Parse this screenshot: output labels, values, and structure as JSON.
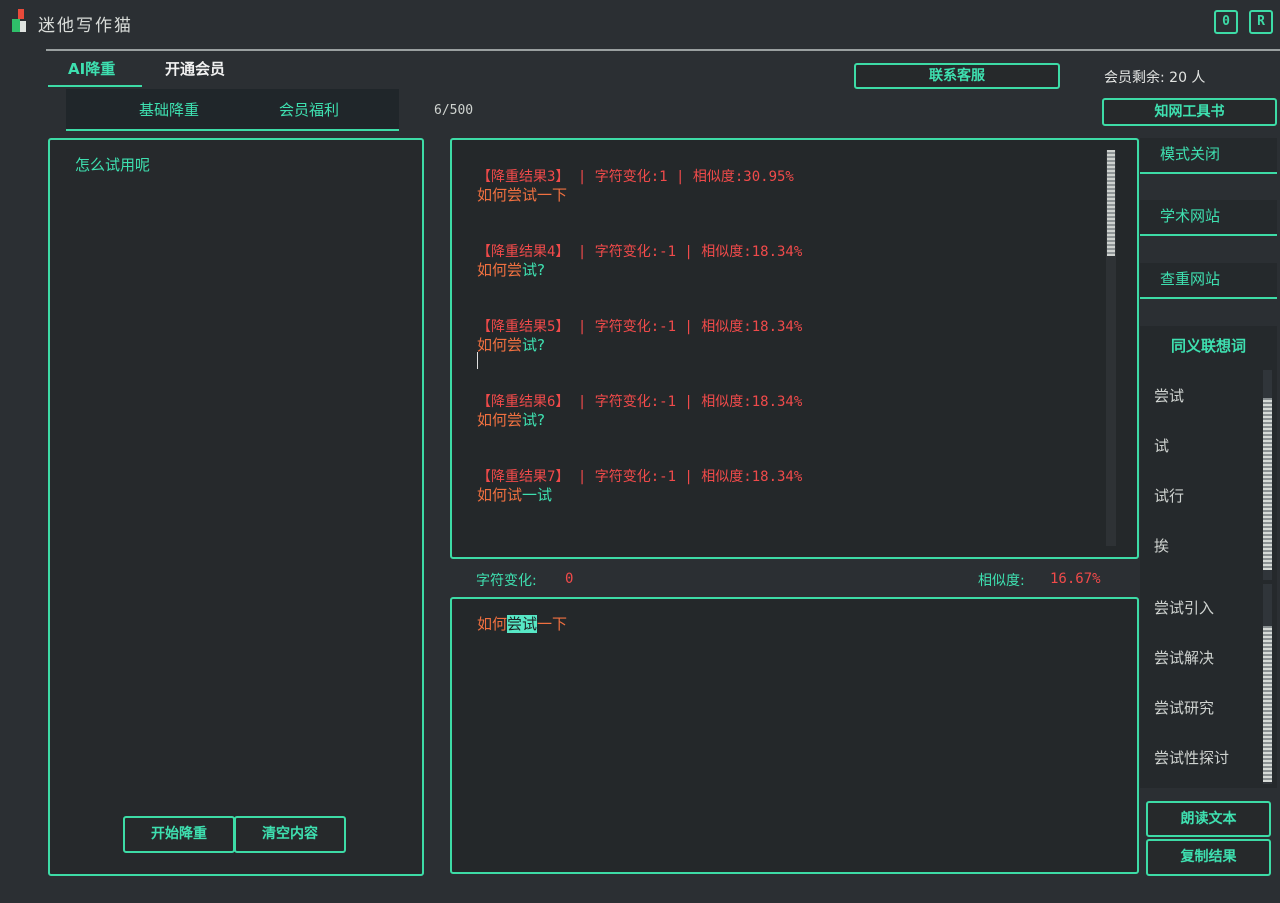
{
  "app": {
    "title": "迷他写作猫",
    "window_buttons": [
      "0",
      "R"
    ]
  },
  "top_tabs": [
    {
      "label": "AI降重",
      "active": true
    },
    {
      "label": "开通会员",
      "active": false
    }
  ],
  "sub_tabs": [
    {
      "label": "基础降重"
    },
    {
      "label": "会员福利"
    }
  ],
  "char_count": "6/500",
  "header": {
    "contact_label": "联系客服",
    "member_remaining": "会员剩余: 20 人",
    "zhiwang_label": "知网工具书"
  },
  "input": {
    "text": "怎么试用呢"
  },
  "actions": {
    "start_label": "开始降重",
    "clear_label": "清空内容",
    "read_label": "朗读文本",
    "copy_label": "复制结果"
  },
  "results": [
    {
      "header": "【降重结果3】 | 字符变化:1 | 相似度:30.95%",
      "text_parts": [
        {
          "t": "如何",
          "g": false
        },
        {
          "t": "尝试",
          "g": false
        },
        {
          "t": "一下",
          "g": false
        }
      ]
    },
    {
      "header": "【降重结果4】 | 字符变化:-1 | 相似度:18.34%",
      "text_parts": [
        {
          "t": "如何",
          "g": false
        },
        {
          "t": "尝",
          "g": false
        },
        {
          "t": "试?",
          "g": true
        }
      ]
    },
    {
      "header": "【降重结果5】 | 字符变化:-1 | 相似度:18.34%",
      "text_parts": [
        {
          "t": "如何",
          "g": false
        },
        {
          "t": "尝",
          "g": false
        },
        {
          "t": "试?",
          "g": true
        }
      ]
    },
    {
      "header": "【降重结果6】 | 字符变化:-1 | 相似度:18.34%",
      "text_parts": [
        {
          "t": "如何",
          "g": false
        },
        {
          "t": "尝",
          "g": false
        },
        {
          "t": "试?",
          "g": true
        }
      ]
    },
    {
      "header": "【降重结果7】 | 字符变化:-1 | 相似度:18.34%",
      "text_parts": [
        {
          "t": "如何",
          "g": false
        },
        {
          "t": "试",
          "g": false
        },
        {
          "t": "一试",
          "g": true
        }
      ]
    }
  ],
  "stats": {
    "change_label": "字符变化:",
    "change_value": "0",
    "similarity_label": "相似度:",
    "similarity_value": "16.67%"
  },
  "edit": {
    "before": "如何",
    "highlight": "尝试",
    "after": "一下"
  },
  "sidebar": {
    "items": [
      "模式关闭",
      "学术网站",
      "查重网站"
    ],
    "synonym_title": "同义联想词",
    "synonyms_top": [
      "尝试",
      "试",
      "试行",
      "挨"
    ],
    "synonyms_bottom": [
      "尝试引入",
      "尝试解决",
      "尝试研究",
      "尝试性探讨"
    ]
  },
  "colors": {
    "accent": "#3ddba6",
    "background": "#2b2f33",
    "result_header": "#f04a4a",
    "result_text": "#f07040"
  }
}
